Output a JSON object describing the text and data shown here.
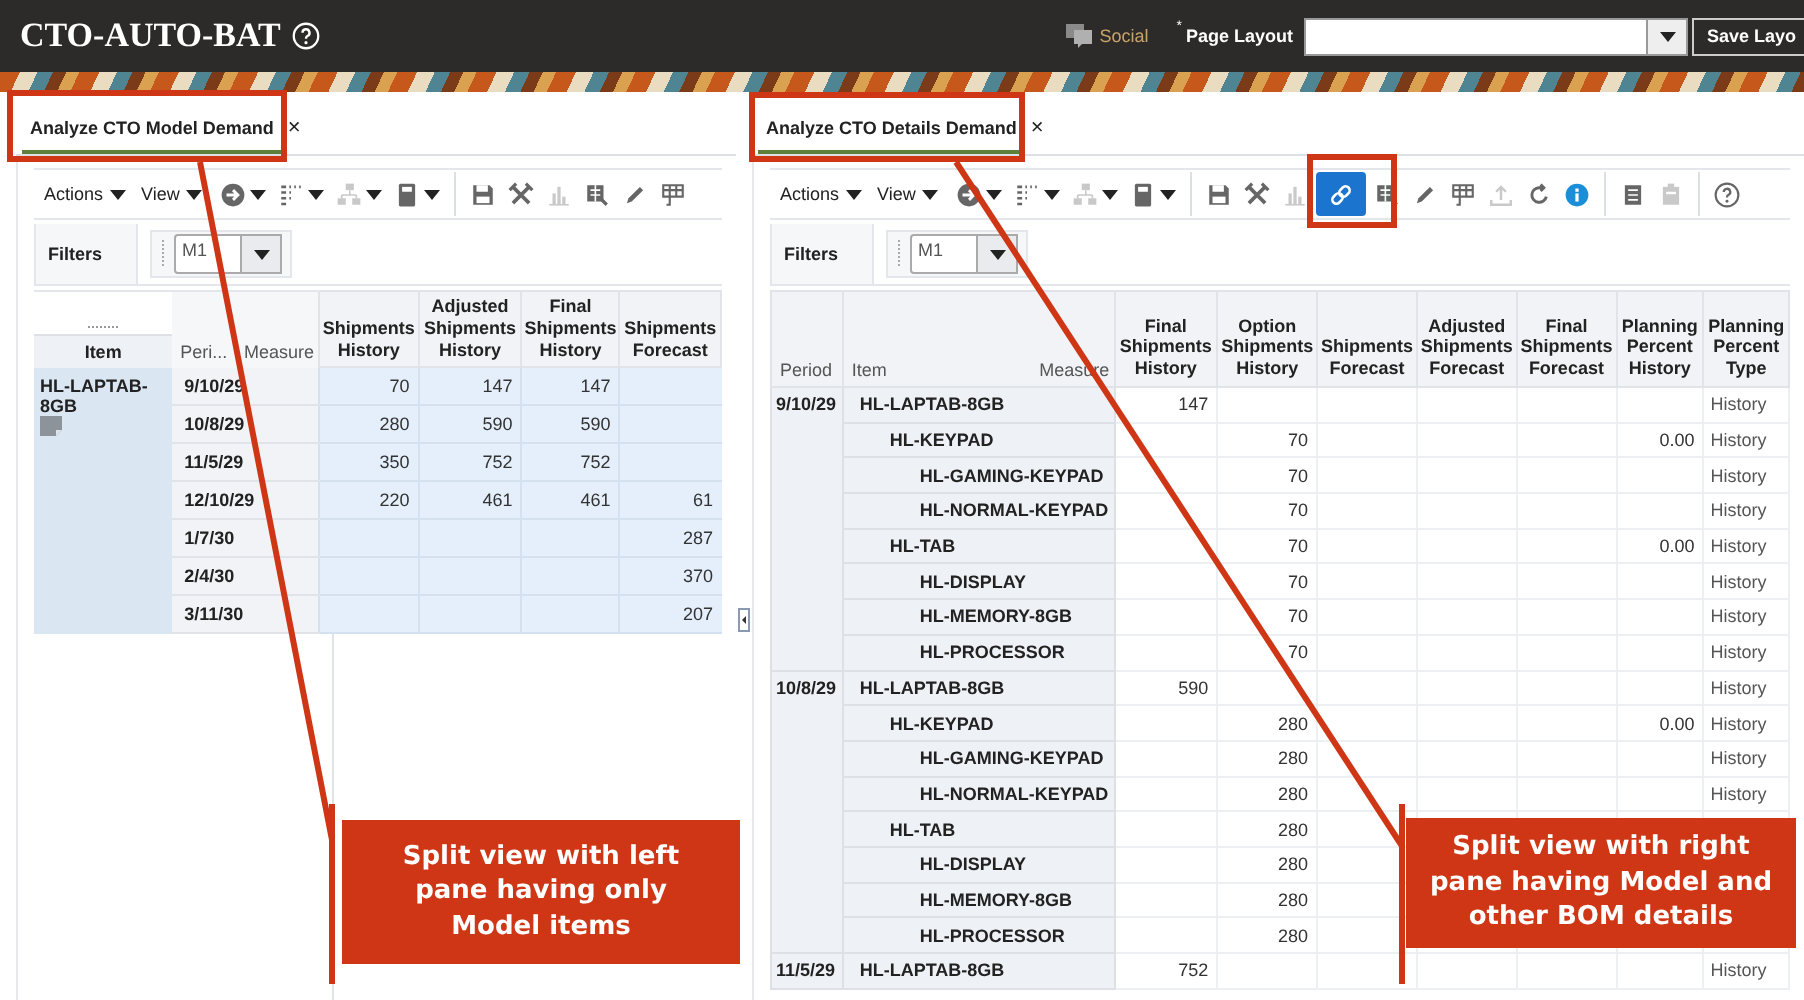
{
  "header": {
    "title": "CTO-AUTO-BAT",
    "social": "Social",
    "required_mark": "*",
    "layout_label": "Page Layout",
    "save_button": "Save Layo"
  },
  "panes": [
    {
      "tab": {
        "label": "Analyze CTO Model Demand",
        "close": "×",
        "selected": true
      },
      "toolbar": {
        "menus": [
          "Actions",
          "View"
        ],
        "tools": [
          {
            "kind": "navigate",
            "dropdown": true,
            "disabled": false,
            "selected": false
          },
          {
            "kind": "layout",
            "dropdown": true,
            "disabled": false,
            "selected": false
          },
          {
            "kind": "hierarchy",
            "dropdown": true,
            "disabled": true,
            "selected": false
          },
          {
            "kind": "calculator",
            "dropdown": true,
            "disabled": false,
            "selected": false
          },
          {
            "kind": "separator"
          },
          {
            "kind": "save",
            "dropdown": false,
            "disabled": false,
            "selected": false
          },
          {
            "kind": "tools",
            "dropdown": false,
            "disabled": false,
            "selected": false
          },
          {
            "kind": "chart",
            "dropdown": false,
            "disabled": true,
            "selected": false
          },
          {
            "kind": "export",
            "dropdown": false,
            "disabled": false,
            "selected": false
          },
          {
            "kind": "pencil",
            "dropdown": false,
            "disabled": false,
            "selected": false
          },
          {
            "kind": "table",
            "dropdown": false,
            "disabled": false,
            "selected": false
          }
        ]
      },
      "filters": {
        "label": "Filters",
        "value": "M1"
      },
      "table": {
        "kind": "model",
        "item_header": "Item",
        "period_header": "Peri...",
        "measure_header": "Measure",
        "columns": [
          "Shipments History",
          "Adjusted Shipments History",
          "Final Shipments History",
          "Shipments Forecast"
        ],
        "item": "HL-LAPTAB-8GB",
        "rows": [
          {
            "period": "9/10/29",
            "values": {
              "shipments_history": "70",
              "adjusted_shipments_history": "147",
              "final_shipments_history": "147"
            }
          },
          {
            "period": "10/8/29",
            "values": {
              "shipments_history": "280",
              "adjusted_shipments_history": "590",
              "final_shipments_history": "590"
            }
          },
          {
            "period": "11/5/29",
            "values": {
              "shipments_history": "350",
              "adjusted_shipments_history": "752",
              "final_shipments_history": "752"
            }
          },
          {
            "period": "12/10/29",
            "values": {
              "shipments_history": "220",
              "adjusted_shipments_history": "461",
              "final_shipments_history": "461",
              "shipments_forecast": "61"
            }
          },
          {
            "period": "1/7/30",
            "values": {
              "shipments_forecast": "287"
            }
          },
          {
            "period": "2/4/30",
            "values": {
              "shipments_forecast": "370"
            }
          },
          {
            "period": "3/11/30",
            "values": {
              "shipments_forecast": "207"
            }
          }
        ]
      }
    },
    {
      "tab": {
        "label": "Analyze CTO Details Demand",
        "close": "×",
        "selected": true
      },
      "toolbar": {
        "menus": [
          "Actions",
          "View"
        ],
        "tools": [
          {
            "kind": "navigate",
            "dropdown": true,
            "disabled": false,
            "selected": false
          },
          {
            "kind": "layout",
            "dropdown": true,
            "disabled": false,
            "selected": false
          },
          {
            "kind": "hierarchy",
            "dropdown": true,
            "disabled": true,
            "selected": false
          },
          {
            "kind": "calculator",
            "dropdown": true,
            "disabled": false,
            "selected": false
          },
          {
            "kind": "separator"
          },
          {
            "kind": "save",
            "dropdown": false,
            "disabled": false,
            "selected": false
          },
          {
            "kind": "tools",
            "dropdown": false,
            "disabled": false,
            "selected": false
          },
          {
            "kind": "chart",
            "dropdown": false,
            "disabled": true,
            "selected": false
          },
          {
            "kind": "link",
            "dropdown": false,
            "disabled": false,
            "selected": true
          },
          {
            "kind": "export",
            "dropdown": false,
            "disabled": false,
            "selected": false
          },
          {
            "kind": "pencil",
            "dropdown": false,
            "disabled": false,
            "selected": false
          },
          {
            "kind": "table",
            "dropdown": false,
            "disabled": false,
            "selected": false
          },
          {
            "kind": "upload",
            "dropdown": false,
            "disabled": true,
            "selected": false
          },
          {
            "kind": "refresh",
            "dropdown": false,
            "disabled": false,
            "selected": false
          },
          {
            "kind": "info",
            "dropdown": false,
            "disabled": false,
            "selected": false
          },
          {
            "kind": "separator"
          },
          {
            "kind": "document",
            "dropdown": false,
            "disabled": false,
            "selected": false
          },
          {
            "kind": "clipboard",
            "dropdown": false,
            "disabled": true,
            "selected": false
          },
          {
            "kind": "separator"
          },
          {
            "kind": "help",
            "dropdown": false,
            "disabled": false,
            "selected": false
          }
        ]
      },
      "filters": {
        "label": "Filters",
        "value": "M1"
      },
      "table": {
        "kind": "bom",
        "period_header": "Period",
        "item_header": "Item",
        "measure_header": "Measure",
        "columns": [
          "Final Shipments History",
          "Option Shipments History",
          "Shipments Forecast",
          "Adjusted Shipments Forecast",
          "Final Shipments Forecast",
          "Planning Percent History",
          "Planning Percent Type"
        ],
        "groups": [
          {
            "period": "9/10/29",
            "items": [
              {
                "name": "HL-LAPTAB-8GB",
                "values": {
                  "final_shipments_history": "147",
                  "planning_percent_type": "History"
                },
                "children": [
                  {
                    "name": "HL-KEYPAD",
                    "values": {
                      "option_shipments_history": "70",
                      "planning_percent_history": "0.00",
                      "planning_percent_type": "History"
                    },
                    "children": [
                      {
                        "name": "HL-GAMING-KEYPAD",
                        "values": {
                          "option_shipments_history": "70",
                          "planning_percent_type": "History"
                        }
                      },
                      {
                        "name": "HL-NORMAL-KEYPAD",
                        "values": {
                          "option_shipments_history": "70",
                          "planning_percent_type": "History"
                        }
                      }
                    ]
                  },
                  {
                    "name": "HL-TAB",
                    "values": {
                      "option_shipments_history": "70",
                      "planning_percent_history": "0.00",
                      "planning_percent_type": "History"
                    },
                    "children": [
                      {
                        "name": "HL-DISPLAY",
                        "values": {
                          "option_shipments_history": "70",
                          "planning_percent_type": "History"
                        }
                      },
                      {
                        "name": "HL-MEMORY-8GB",
                        "values": {
                          "option_shipments_history": "70",
                          "planning_percent_type": "History"
                        }
                      },
                      {
                        "name": "HL-PROCESSOR",
                        "values": {
                          "option_shipments_history": "70",
                          "planning_percent_type": "History"
                        }
                      }
                    ]
                  }
                ]
              }
            ]
          },
          {
            "period": "10/8/29",
            "items": [
              {
                "name": "HL-LAPTAB-8GB",
                "values": {
                  "final_shipments_history": "590",
                  "planning_percent_type": "History"
                },
                "children": [
                  {
                    "name": "HL-KEYPAD",
                    "values": {
                      "option_shipments_history": "280",
                      "planning_percent_history": "0.00",
                      "planning_percent_type": "History"
                    },
                    "children": [
                      {
                        "name": "HL-GAMING-KEYPAD",
                        "values": {
                          "option_shipments_history": "280",
                          "planning_percent_type": "History"
                        }
                      },
                      {
                        "name": "HL-NORMAL-KEYPAD",
                        "values": {
                          "option_shipments_history": "280",
                          "planning_percent_type": "History"
                        }
                      }
                    ]
                  },
                  {
                    "name": "HL-TAB",
                    "values": {
                      "option_shipments_history": "280"
                    },
                    "children": [
                      {
                        "name": "HL-DISPLAY",
                        "values": {
                          "option_shipments_history": "280"
                        }
                      },
                      {
                        "name": "HL-MEMORY-8GB",
                        "values": {
                          "option_shipments_history": "280"
                        }
                      },
                      {
                        "name": "HL-PROCESSOR",
                        "values": {
                          "option_shipments_history": "280"
                        }
                      }
                    ]
                  }
                ]
              }
            ]
          },
          {
            "period": "11/5/29",
            "items": [
              {
                "name": "HL-LAPTAB-8GB",
                "values": {
                  "final_shipments_history": "752",
                  "planning_percent_type": "History"
                }
              }
            ]
          }
        ]
      }
    }
  ],
  "callouts": [
    {
      "text": "Split view with left pane having only Model items"
    },
    {
      "text": "Split view with right pane having Model and other BOM details"
    }
  ]
}
